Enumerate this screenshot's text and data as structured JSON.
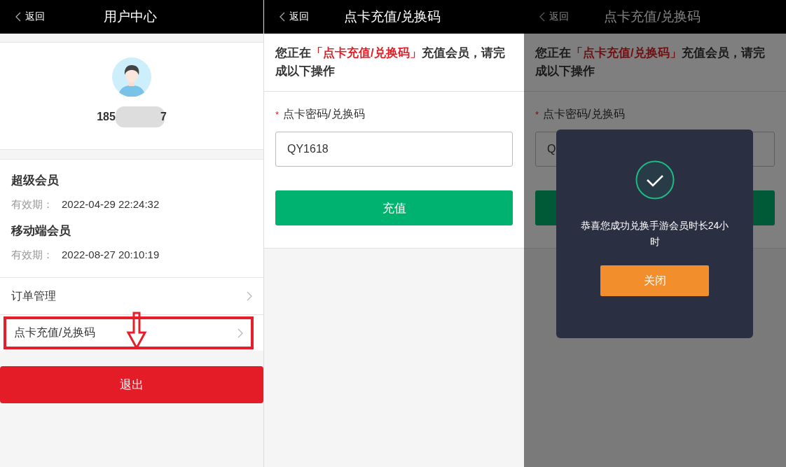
{
  "user_center": {
    "back": "返回",
    "title": "用户中心",
    "phone_start": "185",
    "phone_end": "7",
    "memberships": [
      {
        "name": "超级会员",
        "label": "有效期：",
        "date": "2022-04-29 22:24:32"
      },
      {
        "name": "移动端会员",
        "label": "有效期：",
        "date": "2022-08-27 20:10:19"
      }
    ],
    "menu": [
      {
        "label": "订单管理",
        "highlighted": false
      },
      {
        "label": "点卡充值/兑换码",
        "highlighted": true
      }
    ],
    "logout": "退出"
  },
  "recharge": {
    "back": "返回",
    "title": "点卡充值/兑换码",
    "intro_before": "您正在",
    "intro_highlight": "「点卡充值/兑换码」",
    "intro_after": "充值会员，请完成以下操作",
    "required_mark": "*",
    "field_label": "点卡密码/兑换码",
    "value": "QY1618",
    "submit": "充值"
  },
  "recharge_dialog": {
    "back": "返回",
    "title": "点卡充值/兑换码",
    "intro_before": "您正在",
    "intro_highlight": "「点卡充值/兑换码」",
    "intro_after": "充值会员，请完成以下操作",
    "required_mark": "*",
    "field_label": "点卡密码/兑换码",
    "value": "Q",
    "dialog": {
      "message": "恭喜您成功兑换手游会员时长24小时",
      "close": "关闭"
    }
  }
}
